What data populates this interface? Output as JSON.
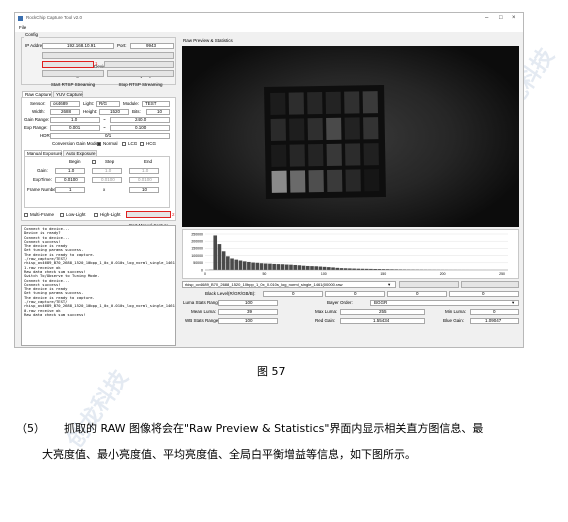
{
  "window": {
    "title": "RockChip Capture Tool v2.0",
    "menu": "File"
  },
  "config": {
    "title": "Config",
    "ip_label": "IP Address:",
    "ip_value": "192.168.10.91",
    "port_label": "Port:",
    "port_value": "9943",
    "device_status": "Device Status",
    "switch_tuning": "Switch To Tuning Mode",
    "mode_query": "Mode Query",
    "start_rtsp": "Start RTSP Streaming",
    "stop_rtsp": "Stop RTSP Streaming"
  },
  "raw": {
    "tab1": "Raw Capture",
    "tab2": "YUV Capture",
    "sensor_label": "Sensor:",
    "sensor_value": "os4689",
    "light_label": "Light:",
    "light_value": "R/G",
    "module_label": "Module:",
    "module_value": "TEST",
    "width_label": "Width:",
    "width_value": "2688",
    "height_label": "Height:",
    "height_value": "1520",
    "bits_label": "Bits:",
    "bits_value": "10",
    "gain_label": "Gain Range:",
    "gain_min": "1.0",
    "gain_max": "240.0",
    "exp_label": "Exp Range:",
    "exp_min": "0.001",
    "exp_max": "0.100",
    "hdr_label": "HDR",
    "hdr_value": "0/1",
    "conv_label": "Conversion Gain Mode:",
    "conv_normal": "Normal",
    "conv_lcg": "LCG",
    "conv_hcg": "HCG"
  },
  "manual": {
    "tab1": "Manual Exposure",
    "tab2": "Auto Exposure",
    "begin": "Begin",
    "step": "Step",
    "end": "End",
    "gain_label": "Gain:",
    "gain_begin": "1.0",
    "gain_step": "1.0",
    "gain_end": "1.0",
    "exp_label": "ExpTime:",
    "exp_begin": "0.0100",
    "exp_step": "0.0100",
    "exp_end": "0.0100",
    "frame_label": "Frame Number:",
    "frame_value": "1",
    "x_label": "x",
    "x_value": "10"
  },
  "options": {
    "multi": "Multi-Frame",
    "low": "Low-Light",
    "high": "High-Light",
    "start_btn": "Start Manual Capture",
    "badge1": "1",
    "badge2": "2"
  },
  "log": [
    "Connect to device...",
    "Device is ready?",
    "Connect to device...",
    "Connect success!",
    "The device is ready",
    "Get tuning params success.",
    "The device is ready to capture.",
    "./raw_capture/TEST/",
    "rkisp_ov4689_B70_2688_1520_10bpp_1_0x_0.010s_log_norml_single_1461(0000",
    "1.raw receive ok",
    "Raw data check sum success!",
    "Switch To/Observe to Tuning Mode.",
    "Connect to device...",
    "Connect success!",
    "The device is ready",
    "Get tuning params success.",
    "The device is ready to capture.",
    "./raw_capture/TEST/",
    "rkisp_ov4689_B70_2688_1520_10bpp_1_0x_0.010s_log_norml_single_1461(0000",
    "0.raw receive ok",
    "Raw data check sum success!"
  ],
  "preview": {
    "title": "Raw Preview & Statistics"
  },
  "chart_data": {
    "type": "histogram",
    "y_ticks": [
      "250000",
      "200000",
      "150000",
      "100000",
      "50000",
      "0"
    ],
    "x_ticks": [
      "0",
      "50",
      "100",
      "150",
      "200",
      "250"
    ],
    "xlim": [
      0,
      255
    ],
    "ylim": [
      0,
      250000
    ],
    "values": [
      0,
      2000,
      240000,
      180000,
      130000,
      95000,
      80000,
      72000,
      66000,
      60000,
      56000,
      52000,
      50000,
      47000,
      45000,
      44000,
      42000,
      41000,
      40000,
      38000,
      37000,
      35000,
      33000,
      30000,
      28000,
      27000,
      26000,
      24000,
      22000,
      20000,
      18000,
      15000,
      13000,
      12000,
      11000,
      10000,
      9000,
      8500,
      8000,
      7500,
      7000,
      6500,
      6000,
      5500,
      5000,
      4500,
      4000,
      3600,
      3200,
      2900,
      2600,
      2300,
      2000,
      1800,
      1500,
      1300,
      1100,
      900,
      700,
      600,
      500,
      400,
      300,
      250,
      200,
      150,
      120,
      100,
      80,
      60,
      40,
      20
    ]
  },
  "stats": {
    "file_value": "rkisp_ov4689_B70_2688_1520_10bpp_1_0x_0.010s_log_norml_single_1461(00000.raw",
    "raw_btn": "Raw",
    "statistic_btn": "Statistic",
    "black_label": "Black Level(R/GR/GB/B):",
    "black_r": "0",
    "black_gr": "0",
    "black_gb": "0",
    "black_b": "0",
    "luma_label": "Luma Stats Range:",
    "luma_value": "100",
    "bayer_label": "Bayer Order:",
    "bayer_value": "BGGR",
    "mean_label": "Mean Luma:",
    "mean_value": "39",
    "max_label": "Max Luma:",
    "max_value": "255",
    "min_label": "Min Luma:",
    "min_value": "0",
    "wb_label": "WB Stats Range:",
    "wb_value": "100",
    "rgain_label": "Red Gain:",
    "rgain_value": "1.55434",
    "bgain_label": "Blue Gain:",
    "bgain_value": "1.09047"
  },
  "doc": {
    "figure_caption": "图 57",
    "para_num": "（5）",
    "para_line1": "抓取的 RAW 图像将会在\"Raw Preview & Statistics\"界面内显示相关直方图信息、最",
    "para_line2": "大亮度值、最小亮度值、平均亮度值、全局白平衡增益等信息，如下图所示。",
    "watermark1": "创龙科技",
    "watermark2": "创龙科技"
  }
}
